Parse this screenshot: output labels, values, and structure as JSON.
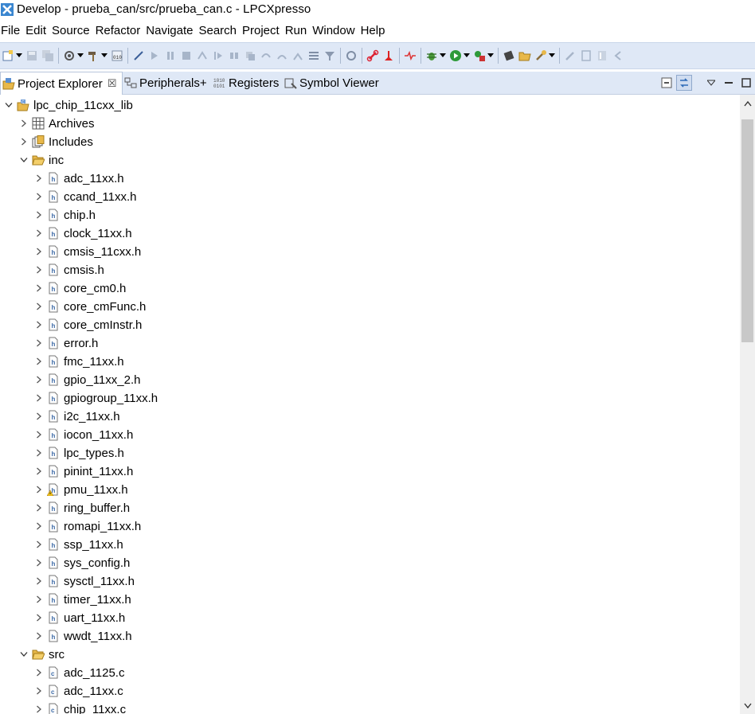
{
  "window": {
    "title": "Develop - prueba_can/src/prueba_can.c - LPCXpresso",
    "icon": "app-x-icon"
  },
  "menubar": [
    "File",
    "Edit",
    "Source",
    "Refactor",
    "Navigate",
    "Search",
    "Project",
    "Run",
    "Window",
    "Help"
  ],
  "tabs": [
    {
      "label": "Project Explorer",
      "icon": "project-explorer-icon",
      "active": true,
      "close": "☒"
    },
    {
      "label": "Peripherals+",
      "icon": "peripherals-icon",
      "active": false
    },
    {
      "label": "Registers",
      "icon": "registers-icon",
      "active": false
    },
    {
      "label": "Symbol Viewer",
      "icon": "symbol-viewer-icon",
      "active": false
    }
  ],
  "tree": {
    "project": "lpc_chip_11cxx_lib",
    "archives": "Archives",
    "includes": "Includes",
    "inc_folder": "inc",
    "inc_files": [
      "adc_11xx.h",
      "ccand_11xx.h",
      "chip.h",
      "clock_11xx.h",
      "cmsis_11cxx.h",
      "cmsis.h",
      "core_cm0.h",
      "core_cmFunc.h",
      "core_cmInstr.h",
      "error.h",
      "fmc_11xx.h",
      "gpio_11xx_2.h",
      "gpiogroup_11xx.h",
      "i2c_11xx.h",
      "iocon_11xx.h",
      "lpc_types.h",
      "pinint_11xx.h",
      "pmu_11xx.h",
      "ring_buffer.h",
      "romapi_11xx.h",
      "ssp_11xx.h",
      "sys_config.h",
      "sysctl_11xx.h",
      "timer_11xx.h",
      "uart_11xx.h",
      "wwdt_11xx.h"
    ],
    "warning_file": "pmu_11xx.h",
    "src_folder": "src",
    "src_files": [
      "adc_1125.c",
      "adc_11xx.c",
      "chip_11xx.c"
    ]
  },
  "colors": {
    "toolbar_bg": "#dfe8f6",
    "tab_bg": "#dfe8f6",
    "accent": "#2e6bb8"
  }
}
